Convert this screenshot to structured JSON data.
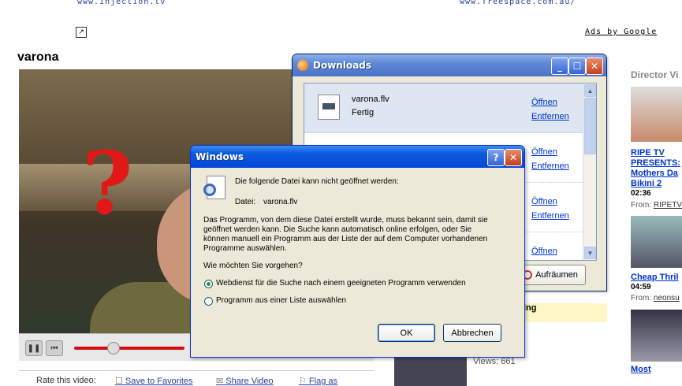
{
  "ads": {
    "link_left": "www.injection.tv",
    "link_right": "www.freespace.com.au/",
    "ads_by": "Ads by Google"
  },
  "video": {
    "title": "varona"
  },
  "rate_bar": {
    "rate_label": "Rate this video:",
    "favorites": "Save to Favorites",
    "share": "Share Video",
    "flag": "Flag as"
  },
  "right_column": {
    "header": "Director Vi",
    "item1_title": [
      "RIPE TV",
      "PRESENTS:",
      "Mothers Da",
      "Bikini 2"
    ],
    "item1_duration": "02:36",
    "item1_from_label": "From:",
    "item1_from": "RIPETV",
    "item2_title": "Cheap Thril",
    "item2_duration": "04:59",
    "item2_from_label": "From:",
    "item2_from": "neonsu",
    "item3_title": "Most"
  },
  "middle": {
    "views": "Views: 661",
    "partial_ing": "ing"
  },
  "downloads": {
    "title": "Downloads",
    "items": [
      {
        "name": "varona.flv",
        "status": "Fertig",
        "open": "Öffnen",
        "remove": "Entfernen"
      },
      {
        "name": "",
        "status": "",
        "open": "Öffnen",
        "remove": "Entfernen"
      },
      {
        "name": "",
        "status": "",
        "open": "Öffnen",
        "remove": "Entfernen"
      },
      {
        "name": "",
        "status": "",
        "open": "Öffnen",
        "remove": ""
      }
    ],
    "clear_button": "Aufräumen"
  },
  "dialog": {
    "title": "Windows",
    "line1": "Die folgende Datei kann nicht geöffnet werden:",
    "file_label": "Datei:",
    "file_name": "varona.flv",
    "para1": "Das Programm, von dem diese Datei erstellt wurde, muss bekannt sein, damit sie",
    "para2": "geöffnet werden kann. Die Suche kann automatisch online erfolgen, oder Sie",
    "para3": "können manuell ein Programm aus der Liste der auf dem Computer vorhandenen",
    "para4": "Programme auswählen.",
    "question": "Wie möchten Sie vorgehen?",
    "option_web": "Webdienst für die Suche nach einem geeigneten Programm verwenden",
    "option_list": "Programm aus einer Liste auswählen",
    "ok": "OK",
    "cancel": "Abbrechen"
  },
  "colors": {
    "xp_title": "#0548d6",
    "link_blue": "#0033cc",
    "seek_red": "#d01010"
  }
}
